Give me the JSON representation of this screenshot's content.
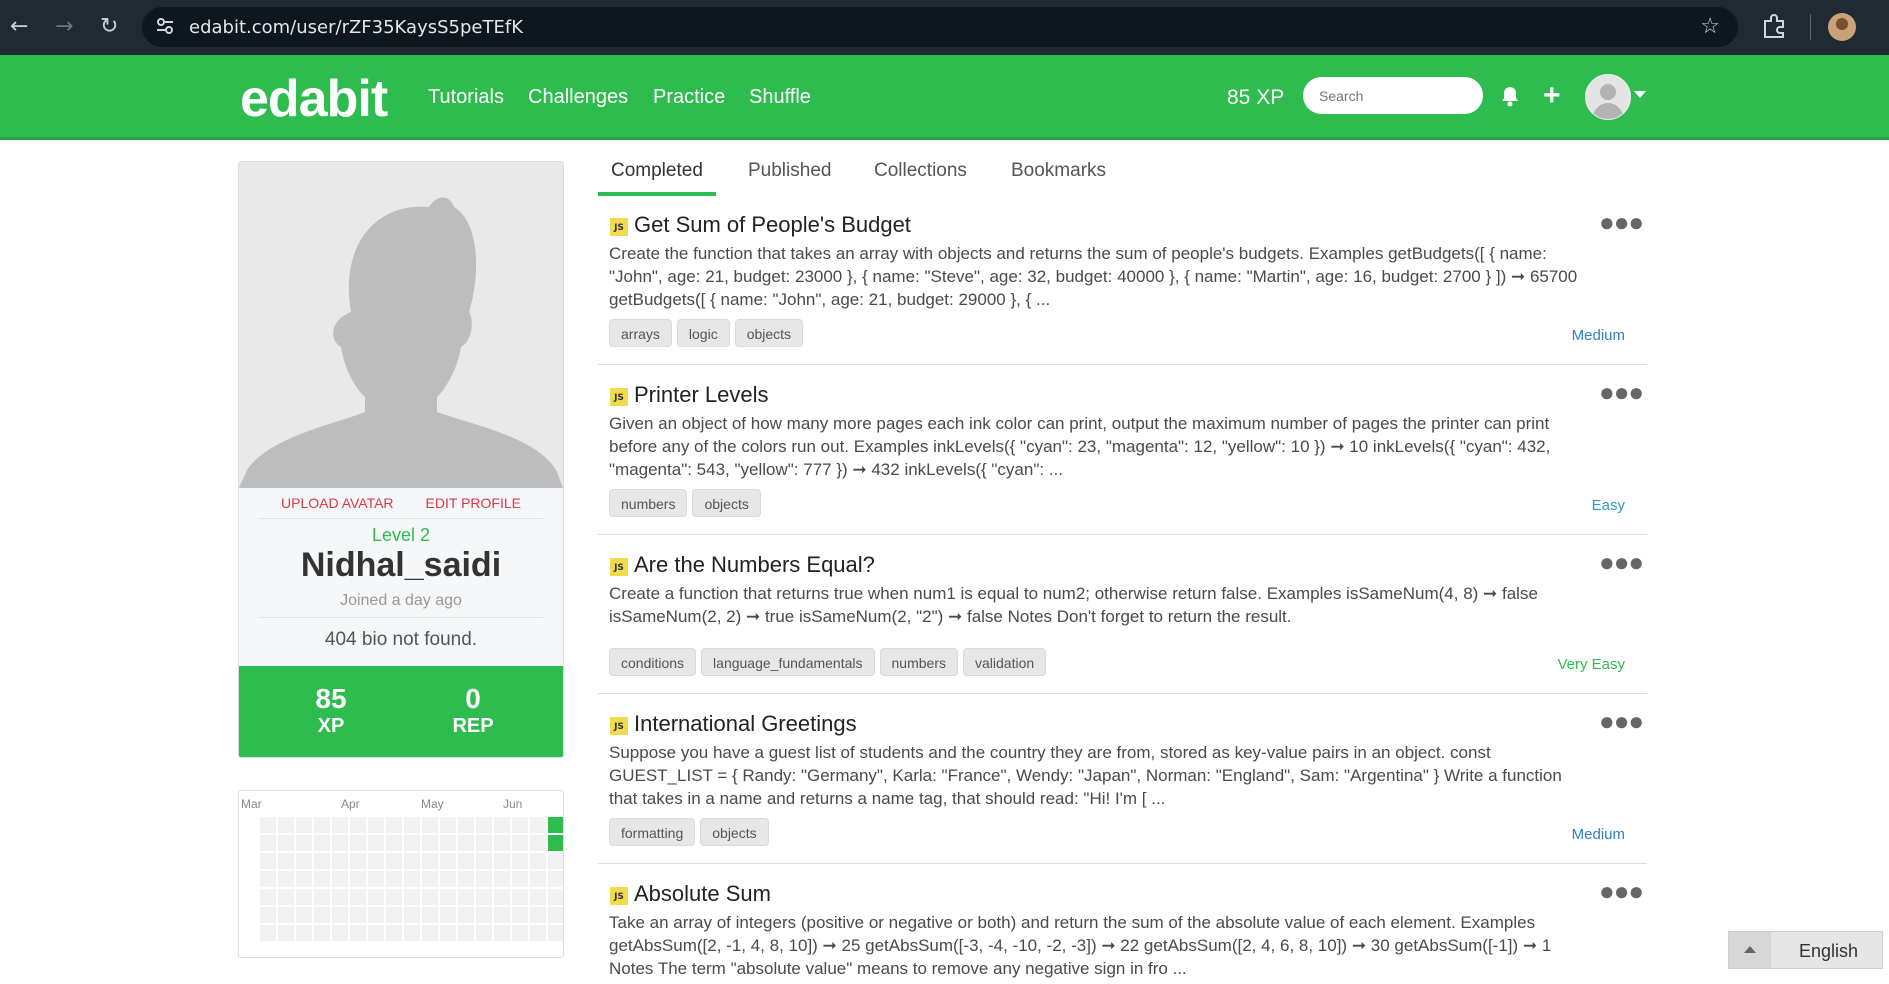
{
  "browser": {
    "url": "edabit.com/user/rZF35KaysS5peTEfK"
  },
  "header": {
    "logo": "edabit",
    "nav": [
      "Tutorials",
      "Challenges",
      "Practice",
      "Shuffle"
    ],
    "xp": "85 XP",
    "search_placeholder": "Search"
  },
  "profile": {
    "upload_avatar": "UPLOAD AVATAR",
    "edit_profile": "EDIT PROFILE",
    "level": "Level 2",
    "username": "Nidhal_saidi",
    "joined": "Joined a day ago",
    "bio": "404 bio not found.",
    "xp_value": "85",
    "xp_label": "XP",
    "rep_value": "0",
    "rep_label": "REP"
  },
  "activity": {
    "months": [
      "Mar",
      "Apr",
      "May",
      "Jun"
    ],
    "active_cells": 2,
    "active_color": "#2ebc4f"
  },
  "tabs": [
    "Completed",
    "Published",
    "Collections",
    "Bookmarks"
  ],
  "challenges": [
    {
      "title": "Get Sum of People's Budget",
      "description": "Create the function that takes an array with objects and returns the sum of people's budgets. Examples getBudgets([ { name: \"John\", age: 21, budget: 23000 }, { name: \"Steve\", age: 32, budget: 40000 }, { name: \"Martin\", age: 16, budget: 2700 } ]) ➞ 65700 getBudgets([ { name: \"John\", age: 21, budget: 29000 }, { ...",
      "tags": [
        "arrays",
        "logic",
        "objects"
      ],
      "difficulty": "Medium",
      "difficulty_color": "#2f7fc1"
    },
    {
      "title": "Printer Levels",
      "description": "Given an object of how many more pages each ink color can print, output the maximum number of pages the printer can print before any of the colors run out. Examples inkLevels({ \"cyan\": 23, \"magenta\": 12, \"yellow\": 10 }) ➞ 10 inkLevels({ \"cyan\": 432, \"magenta\": 543, \"yellow\": 777 }) ➞ 432 inkLevels({ \"cyan\": ...",
      "tags": [
        "numbers",
        "objects"
      ],
      "difficulty": "Easy",
      "difficulty_color": "#2a9ec2"
    },
    {
      "title": "Are the Numbers Equal?",
      "description": "Create a function that returns true when num1 is equal to num2; otherwise return false. Examples isSameNum(4, 8) ➞ false isSameNum(2, 2) ➞ true isSameNum(2, \"2\") ➞ false Notes Don't forget to return the result.",
      "tags": [
        "conditions",
        "language_fundamentals",
        "numbers",
        "validation"
      ],
      "difficulty": "Very Easy",
      "difficulty_color": "#2ebc4f"
    },
    {
      "title": "International Greetings",
      "description": "Suppose you have a guest list of students and the country they are from, stored as key-value pairs in an object. const GUEST_LIST = { Randy: \"Germany\", Karla: \"France\", Wendy: \"Japan\", Norman: \"England\", Sam: \"Argentina\" } Write a function that takes in a name and returns a name tag, that should read: \"Hi! I'm [ ...",
      "tags": [
        "formatting",
        "objects"
      ],
      "difficulty": "Medium",
      "difficulty_color": "#2f7fc1"
    },
    {
      "title": "Absolute Sum",
      "description": "Take an array of integers (positive or negative or both) and return the sum of the absolute value of each element. Examples getAbsSum([2, -1, 4, 8, 10]) ➞ 25 getAbsSum([-3, -4, -10, -2, -3]) ➞ 22 getAbsSum([2, 4, 6, 8, 10]) ➞ 30 getAbsSum([-1]) ➞ 1 Notes The term \"absolute value\" means to remove any negative sign in fro ...",
      "tags": [],
      "difficulty": "",
      "difficulty_color": "#2ebc4f"
    }
  ],
  "language": "English"
}
